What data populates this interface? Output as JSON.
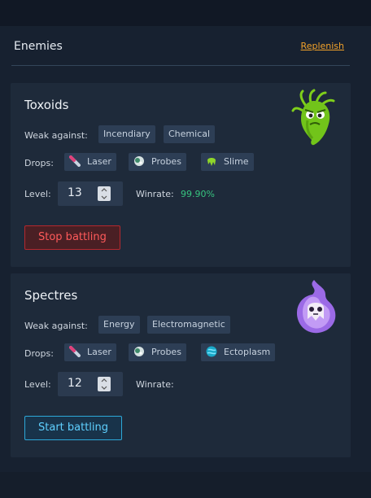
{
  "header": {
    "title": "Enemies",
    "replenish_label": "Replenish"
  },
  "enemies": [
    {
      "name": "Toxoids",
      "weak_label": "Weak against:",
      "weak": [
        "Incendiary",
        "Chemical"
      ],
      "drops_label": "Drops:",
      "drops": [
        {
          "label": "Laser",
          "icon": "laser-icon"
        },
        {
          "label": "Probes",
          "icon": "probes-icon"
        },
        {
          "label": "Slime",
          "icon": "slime-icon"
        }
      ],
      "level_label": "Level:",
      "level": "13",
      "winrate_label": "Winrate:",
      "winrate": "99.90%",
      "button": "Stop battling",
      "mascot": "green-toxoid-creature"
    },
    {
      "name": "Spectres",
      "weak_label": "Weak against:",
      "weak": [
        "Energy",
        "Electromagnetic"
      ],
      "drops_label": "Drops:",
      "drops": [
        {
          "label": "Laser",
          "icon": "laser-icon"
        },
        {
          "label": "Probes",
          "icon": "probes-icon"
        },
        {
          "label": "Ectoplasm",
          "icon": "ectoplasm-icon"
        }
      ],
      "level_label": "Level:",
      "level": "12",
      "winrate_label": "Winrate:",
      "winrate": "",
      "button": "Start battling",
      "mascot": "purple-spectre-ghost"
    }
  ],
  "colors": {
    "accent_orange": "#f2a22a",
    "winrate_green": "#37c47f",
    "stop_red": "#ff5a5a",
    "start_blue": "#5fd0ff"
  }
}
